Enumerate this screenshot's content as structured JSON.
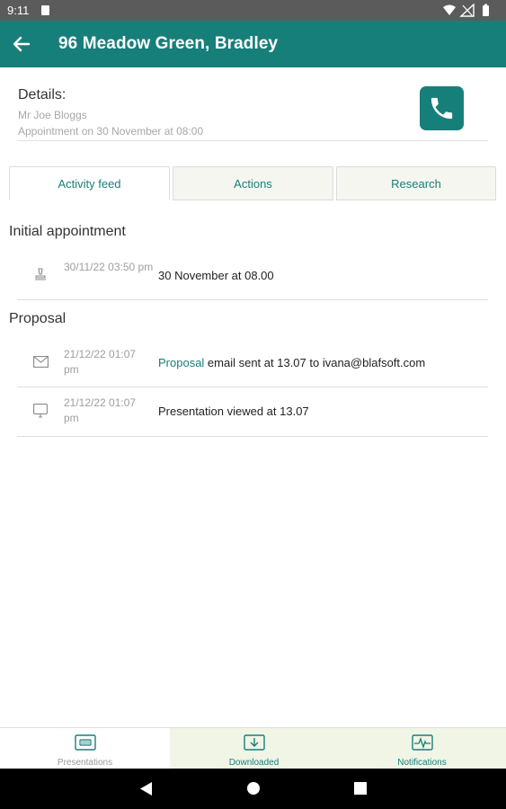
{
  "status_bar": {
    "time": "9:11"
  },
  "app_bar": {
    "title": "96 Meadow Green, Bradley"
  },
  "details": {
    "label": "Details:",
    "customer": "Mr Joe Bloggs",
    "appointment": "Appointment on 30 November at 08:00"
  },
  "tabs": [
    {
      "label": "Activity feed",
      "active": true
    },
    {
      "label": "Actions",
      "active": false
    },
    {
      "label": "Research",
      "active": false
    }
  ],
  "sections": {
    "initial": {
      "title": "Initial appointment",
      "rows": [
        {
          "icon": "stamp-icon",
          "date": "30/11/22 03:50 pm",
          "text": "30 November at 08.00"
        }
      ]
    },
    "proposal": {
      "title": "Proposal",
      "rows": [
        {
          "icon": "email-icon",
          "date": "21/12/22 01:07 pm",
          "link": "Proposal",
          "text": " email sent at 13.07 to ivana@blafsoft.com"
        },
        {
          "icon": "monitor-icon",
          "date": "21/12/22 01:07 pm",
          "text": "Presentation viewed at 13.07"
        }
      ]
    }
  },
  "bottom_nav": [
    {
      "label": "Presentations",
      "icon": "presentation-icon"
    },
    {
      "label": "Downloaded",
      "icon": "download-icon"
    },
    {
      "label": "Notifications",
      "icon": "activity-icon"
    }
  ],
  "colors": {
    "primary": "#177f7a",
    "status_bar": "#5b5b5b",
    "nav_bg": "#f0f5e6"
  }
}
